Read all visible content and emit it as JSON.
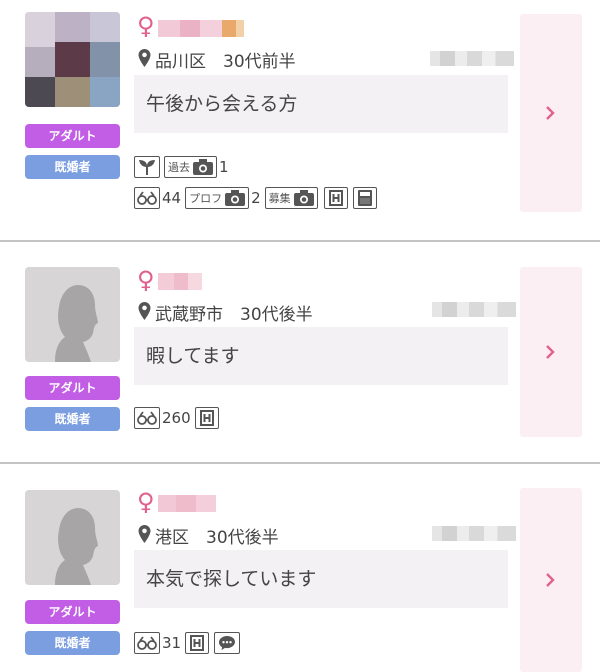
{
  "cards": [
    {
      "badges": {
        "adult": "アダルト",
        "married": "既婚者"
      },
      "location": "品川区　30代前半",
      "message": "午後から会える方",
      "icons": {
        "past_label": "過去",
        "past_count": "1",
        "views": "44",
        "profile_label": "プロフ",
        "profile_count": "2",
        "recruit_label": "募集"
      }
    },
    {
      "badges": {
        "adult": "アダルト",
        "married": "既婚者"
      },
      "location": "武蔵野市　30代後半",
      "message": "暇してます",
      "icons": {
        "views": "260"
      }
    },
    {
      "badges": {
        "adult": "アダルト",
        "married": "既婚者"
      },
      "location": "港区　30代後半",
      "message": "本気で探しています",
      "icons": {
        "views": "31"
      }
    }
  ],
  "colors": {
    "adult_badge": "#c25ee6",
    "married_badge": "#7b9ee0",
    "female_symbol": "#e0608e",
    "arrow_panel": "#fceff3"
  }
}
